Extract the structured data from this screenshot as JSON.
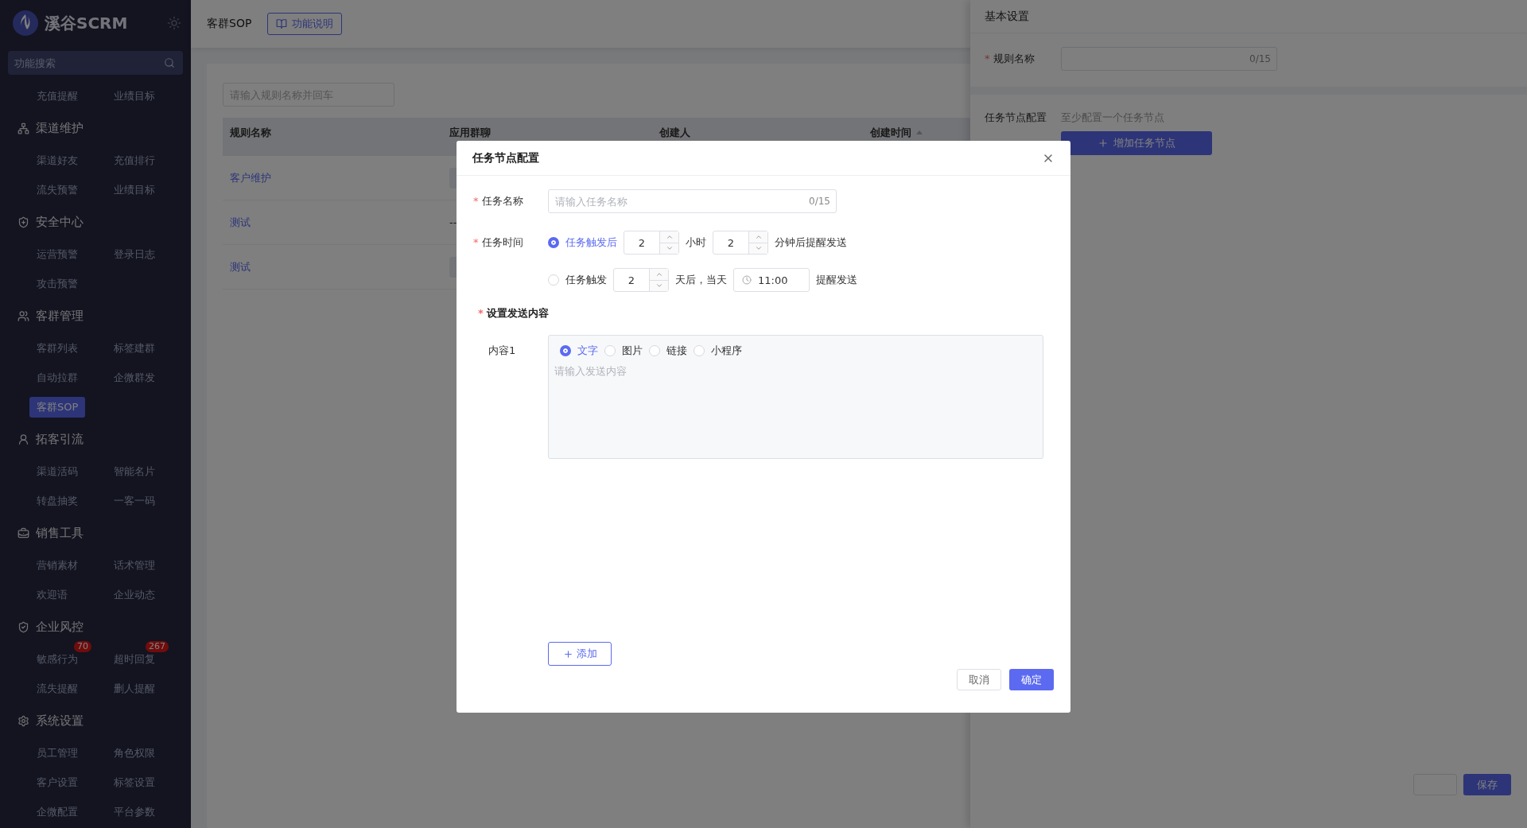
{
  "sidebar": {
    "brand": "溪谷SCRM",
    "search": {
      "placeholder": "功能搜索"
    },
    "groups": [
      {
        "items": [
          {
            "label": "充值提醒",
            "selected": false
          },
          {
            "label": "业绩目标",
            "selected": false
          }
        ]
      },
      {
        "title": "渠道维护",
        "items": [
          {
            "label": "渠道好友",
            "selected": false
          },
          {
            "label": "充值排行",
            "selected": false
          },
          {
            "label": "流失预警",
            "selected": false
          },
          {
            "label": "业绩目标",
            "selected": false
          }
        ]
      },
      {
        "title": "安全中心",
        "items": [
          {
            "label": "运营预警",
            "selected": false
          },
          {
            "label": "登录日志",
            "selected": false
          },
          {
            "label": "攻击预警",
            "selected": false
          }
        ]
      },
      {
        "title": "客群管理",
        "items": [
          {
            "label": "客群列表",
            "selected": false
          },
          {
            "label": "标签建群",
            "selected": false
          },
          {
            "label": "自动拉群",
            "selected": false
          },
          {
            "label": "企微群发",
            "selected": false
          },
          {
            "label": "客群SOP",
            "selected": true
          }
        ]
      },
      {
        "title": "拓客引流",
        "items": [
          {
            "label": "渠道活码",
            "selected": false
          },
          {
            "label": "智能名片",
            "selected": false
          },
          {
            "label": "转盘抽奖",
            "selected": false
          },
          {
            "label": "一客一码",
            "selected": false
          }
        ]
      },
      {
        "title": "销售工具",
        "items": [
          {
            "label": "营销素材",
            "selected": false
          },
          {
            "label": "话术管理",
            "selected": false
          },
          {
            "label": "欢迎语",
            "selected": false
          },
          {
            "label": "企业动态",
            "selected": false
          }
        ]
      },
      {
        "title": "企业风控",
        "items": [
          {
            "label": "敏感行为",
            "selected": false,
            "badge": "70"
          },
          {
            "label": "超时回复",
            "selected": false,
            "badge": "267"
          },
          {
            "label": "流失提醒",
            "selected": false
          },
          {
            "label": "删人提醒",
            "selected": false
          }
        ]
      },
      {
        "title": "系统设置",
        "items": [
          {
            "label": "员工管理",
            "selected": false
          },
          {
            "label": "角色权限",
            "selected": false
          },
          {
            "label": "客户设置",
            "selected": false
          },
          {
            "label": "标签设置",
            "selected": false
          },
          {
            "label": "企微配置",
            "selected": false
          },
          {
            "label": "平台参数",
            "selected": false
          }
        ]
      }
    ]
  },
  "header": {
    "title": "客群SOP",
    "help_button": "功能说明"
  },
  "list": {
    "search": {
      "placeholder": "请输入规则名称并回车"
    },
    "columns": [
      {
        "label": "规则名称",
        "sortable": false
      },
      {
        "label": "应用群聊",
        "sortable": false
      },
      {
        "label": "创建人",
        "sortable": false
      },
      {
        "label": "创建时间",
        "sortable": true
      }
    ],
    "rows": [
      {
        "cells": [
          {
            "kind": "link",
            "text": "客户维护"
          },
          {
            "kind": "tag"
          }
        ]
      },
      {
        "cells": [
          {
            "kind": "link",
            "text": "测试"
          },
          {
            "kind": "text",
            "text": "--"
          }
        ]
      },
      {
        "cells": [
          {
            "kind": "link",
            "text": "测试"
          },
          {
            "kind": "tag"
          }
        ]
      }
    ]
  },
  "drawer": {
    "title": "基本设置",
    "rule_name": {
      "label": "规则名称",
      "required_mark": "*",
      "counter": "0/15"
    },
    "nodes": {
      "label": "任务节点配置",
      "hint": "至少配置一个任务节点",
      "add_button": "增加任务节点"
    },
    "save_button": "保存"
  },
  "modal": {
    "title": "任务节点配置",
    "task_name": {
      "label": "任务名称",
      "required_mark": "*",
      "placeholder": "请输入任务名称",
      "counter": "0/15"
    },
    "task_time": {
      "label": "任务时间",
      "required_mark": "*",
      "options": [
        {
          "selected": true,
          "label": "任务触发后",
          "parts": [
            {
              "kind": "number",
              "value": "2"
            },
            {
              "kind": "text",
              "text": "小时"
            },
            {
              "kind": "number",
              "value": "2"
            },
            {
              "kind": "text",
              "text": "分钟后提醒发送"
            }
          ]
        },
        {
          "selected": false,
          "label": "任务触发",
          "parts": [
            {
              "kind": "number",
              "value": "2"
            },
            {
              "kind": "text",
              "text": "天后，当天"
            },
            {
              "kind": "time",
              "value": "11:00"
            },
            {
              "kind": "text",
              "text": "提醒发送"
            }
          ]
        }
      ]
    },
    "content": {
      "label": "设置发送内容",
      "required_mark": "*",
      "items": [
        {
          "label": "内容1",
          "types": [
            {
              "label": "文字",
              "selected": true
            },
            {
              "label": "图片",
              "selected": false
            },
            {
              "label": "链接",
              "selected": false
            },
            {
              "label": "小程序",
              "selected": false
            }
          ],
          "placeholder": "请输入发送内容"
        }
      ],
      "add_button": "添加"
    },
    "cancel_button": "取消",
    "confirm_button": "确定"
  }
}
